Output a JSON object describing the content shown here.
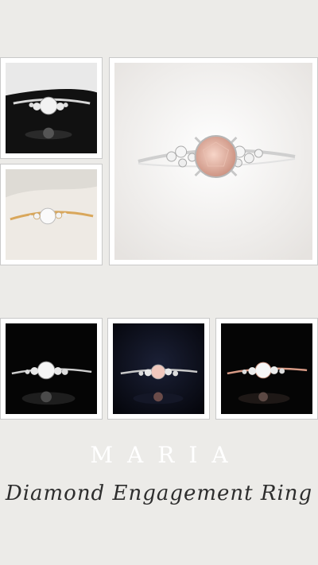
{
  "colors": {
    "background": "#ecebe8",
    "title": "#ffffff",
    "subtitle": "#2d2d2d",
    "frame": "#ffffff"
  },
  "photos": [
    {
      "name": "photo-white-gold-ring-dark",
      "description_icon": "ring-icon",
      "metal": "white-gold",
      "stone": "clear",
      "bg": "dark"
    },
    {
      "name": "photo-yellow-gold-ring",
      "description_icon": "ring-icon",
      "metal": "yellow-gold",
      "stone": "clear",
      "bg": "light"
    },
    {
      "name": "photo-white-gold-pink-ring",
      "description_icon": "ring-icon",
      "metal": "white-gold",
      "stone": "pink",
      "bg": "light"
    },
    {
      "name": "photo-white-gold-ring-black",
      "description_icon": "ring-icon",
      "metal": "white-gold",
      "stone": "clear",
      "bg": "black"
    },
    {
      "name": "photo-white-gold-pink-ring-navy",
      "description_icon": "ring-icon",
      "metal": "white-gold",
      "stone": "pink",
      "bg": "navy"
    },
    {
      "name": "photo-rose-gold-ring-black",
      "description_icon": "ring-icon",
      "metal": "rose-gold",
      "stone": "clear",
      "bg": "black"
    }
  ],
  "heading": {
    "title": "MARIA",
    "subtitle": "Diamond Engagement Ring"
  }
}
